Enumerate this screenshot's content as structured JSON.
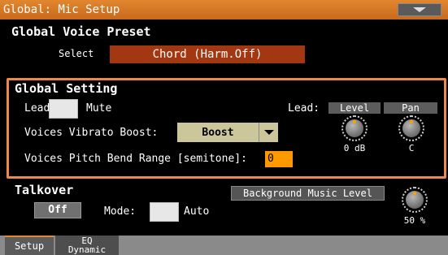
{
  "title": "Global: Mic Setup",
  "voice_preset": {
    "section_title": "Global Voice Preset",
    "select_label": "Select",
    "select_value": "Chord (Harm.Off)"
  },
  "global_setting": {
    "section_title": "Global Setting",
    "lead_label": "Lead:",
    "mute_label": "Mute",
    "lead_label_right": "Lead:",
    "level_header": "Level",
    "pan_header": "Pan",
    "vibrato_label": "Voices Vibrato Boost:",
    "vibrato_value": "Boost",
    "pitch_bend_label": "Voices Pitch Bend Range [semitone]:",
    "pitch_bend_value": "0",
    "level_value": "0 dB",
    "pan_value": "C"
  },
  "talkover": {
    "section_title": "Talkover",
    "off_button": "Off",
    "mode_label": "Mode:",
    "auto_label": "Auto",
    "bg_music_button": "Background Music Level",
    "bg_music_value": "50 %"
  },
  "tabs": {
    "setup": "Setup",
    "eq_line1": "EQ",
    "eq_line2": "Dynamic"
  },
  "colors": {
    "title_bar": "#d8782a",
    "select_field": "#a33712",
    "frame": "#e98a4c",
    "dropdown": "#ccc79a",
    "num_field": "#ff9900"
  }
}
